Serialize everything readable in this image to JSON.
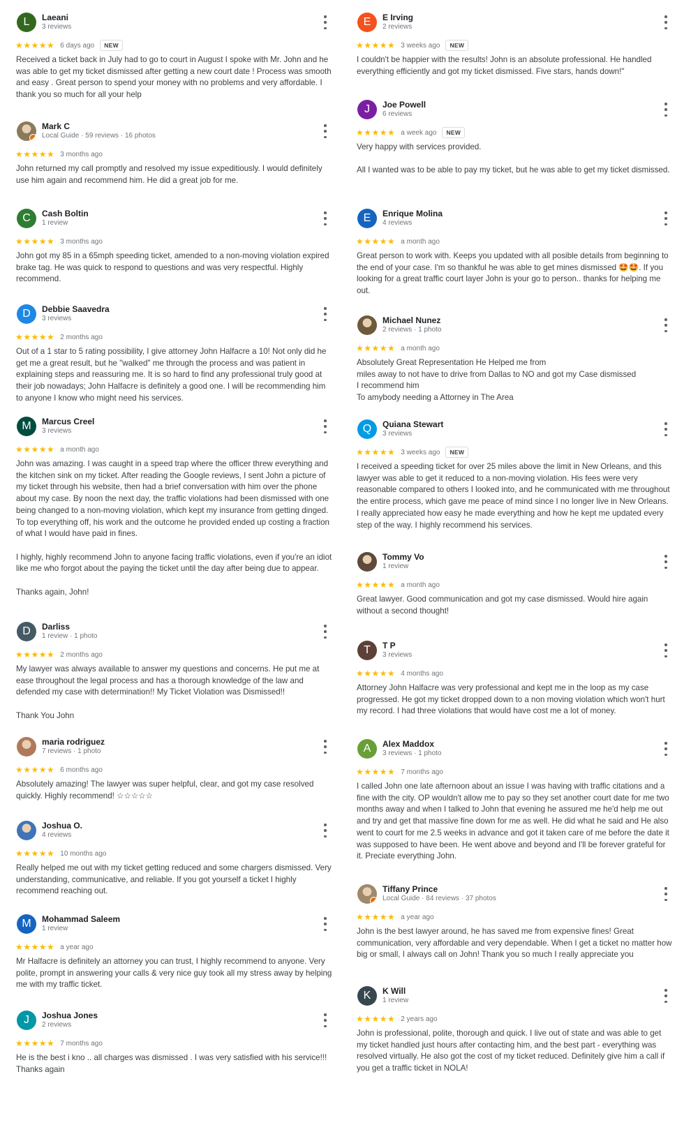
{
  "reviews_left": [
    {
      "name": "Laeani",
      "meta": "3 reviews",
      "initial": "L",
      "color": "#33691e",
      "photo": false,
      "stars": "★★★★★",
      "date": "6 days ago",
      "new": "NEW",
      "text": "Received a ticket back in July had to go to court in August I spoke with Mr. John and he was able to get my ticket dismissed after getting a new court date ! Process was smooth and easy . Great person to spend your money with no problems and very affordable. I thank you so much for all your help"
    },
    {
      "name": "Mark C",
      "meta": "Local Guide · 59 reviews · 16 photos",
      "initial": "M",
      "color": "#8a7a5c",
      "photo": true,
      "badge": true,
      "stars": "★★★★★",
      "date": "3 months ago",
      "new": "",
      "text": "John returned my call promptly and resolved my issue expeditiously. I would definitely use him again and recommend him. He did a great job for me."
    },
    {
      "name": "Cash Boltin",
      "meta": "1 review",
      "initial": "C",
      "color": "#2e7d32",
      "photo": false,
      "stars": "★★★★★",
      "date": "3 months ago",
      "new": "",
      "text": "John got my 85 in a 65mph speeding ticket, amended to a non-moving violation expired brake tag. He was quick to respond to questions and was very respectful. Highly recommend."
    },
    {
      "name": "Debbie Saavedra",
      "meta": "3 reviews",
      "initial": "D",
      "color": "#1e88e5",
      "photo": false,
      "stars": "★★★★★",
      "date": "2 months ago",
      "new": "",
      "text": "Out of a 1 star to 5 rating possibility, I give attorney John Halfacre a 10! Not only did he get me a great result, but he \"walked\" me through the process and was patient in explaining steps and reassuring me. It is so hard to find any professional truly good at their job nowadays; John Halfacre is definitely a good one. I will be recommending him to anyone I know who might need his services."
    },
    {
      "name": "Marcus Creel",
      "meta": "3 reviews",
      "initial": "M",
      "color": "#004d40",
      "photo": false,
      "stars": "★★★★★",
      "date": "a month ago",
      "new": "",
      "text": "John was amazing. I was caught in a speed trap where the officer threw everything and the kitchen sink on my ticket. After reading the Google reviews, I sent John a picture of my ticket through his website, then had a brief conversation with him over the phone about my case. By noon the next day, the traffic violations had been dismissed with one being changed to a non-moving violation, which kept my insurance from getting dinged. To top everything off, his work and the outcome he provided ended up costing a fraction of what I would have paid in fines.\n\nI highly, highly recommend John to anyone facing traffic violations, even if you're an idiot like me who forgot about the paying the ticket until the day after being due to appear.\n\nThanks again, John!"
    },
    {
      "name": "Darliss",
      "meta": "1 review · 1 photo",
      "initial": "D",
      "color": "#455a64",
      "photo": false,
      "stars": "★★★★★",
      "date": "2 months ago",
      "new": "",
      "text": "My lawyer was always available to answer my questions and concerns. He put me at ease throughout the legal process and has a thorough knowledge of the law and defended my case with determination!! My Ticket Violation was Dismissed!!\n\nThank You John"
    },
    {
      "name": "maria rodriguez",
      "meta": "7 reviews · 1 photo",
      "initial": "m",
      "color": "#b07a5a",
      "photo": true,
      "stars": "★★★★★",
      "date": "6 months ago",
      "new": "",
      "text": "Absolutely amazing! The lawyer was super helpful, clear, and got my case resolved quickly. Highly recommend! ☆☆☆☆☆"
    },
    {
      "name": "Joshua O.",
      "meta": "4 reviews",
      "initial": "J",
      "color": "#3f74b8",
      "photo": true,
      "stars": "★★★★★",
      "date": "10 months ago",
      "new": "",
      "text": "Really helped me out with my ticket getting reduced and some chargers dismissed. Very understanding, communicative, and reliable. If you got yourself a ticket I highly recommend reaching out."
    },
    {
      "name": "Mohammad Saleem",
      "meta": "1 review",
      "initial": "M",
      "color": "#1565c0",
      "photo": false,
      "stars": "★★★★★",
      "date": "a year ago",
      "new": "",
      "text": "Mr Halfacre is definitely an attorney you can trust, I highly recommend to anyone. Very polite, prompt in answering your calls & very nice guy took all my stress away by helping me with my traffic ticket."
    },
    {
      "name": "Joshua Jones",
      "meta": "2 reviews",
      "initial": "J",
      "color": "#0097a7",
      "photo": false,
      "stars": "★★★★★",
      "date": "7 months ago",
      "new": "",
      "text": "He is the best i kno .. all charges was dismissed . I was very satisfied with his service!!! Thanks again"
    }
  ],
  "reviews_right": [
    {
      "name": "E Irving",
      "meta": "2 reviews",
      "initial": "E",
      "color": "#f4511e",
      "photo": false,
      "stars": "★★★★★",
      "date": "3 weeks ago",
      "new": "NEW",
      "text": "I couldn't be happier with the results! John is an absolute professional. He handled everything efficiently and got my ticket dismissed. Five stars, hands down!\""
    },
    {
      "name": "Joe Powell",
      "meta": "6 reviews",
      "initial": "J",
      "color": "#7b1fa2",
      "photo": false,
      "stars": "★★★★★",
      "date": "a week ago",
      "new": "NEW",
      "text": "Very happy with services provided.\n\nAll I wanted was to be able to pay my ticket, but he was able to get my ticket dismissed."
    },
    {
      "name": "Enrique Molina",
      "meta": "4 reviews",
      "initial": "E",
      "color": "#1565c0",
      "photo": false,
      "stars": "★★★★★",
      "date": "a month ago",
      "new": "",
      "text": "Great person to work with. Keeps you updated with all posible details from beginning to the end of your case. I'm so thankful he was able to get mines dismissed 🤩🤩. If you looking for a great traffic court layer John is your go to person.. thanks for helping me out."
    },
    {
      "name": "Michael Nunez",
      "meta": "2 reviews · 1 photo",
      "initial": "M",
      "color": "#6d5a3a",
      "photo": true,
      "stars": "★★★★★",
      "date": "a month ago",
      "new": "",
      "text": "Absolutely Great Representation He Helped me from\nmiles away to not have to drive from Dallas to NO and got my Case dismissed\nI recommend him\nTo amybody needing a Attorney in The Area"
    },
    {
      "name": "Quiana Stewart",
      "meta": "3 reviews",
      "initial": "Q",
      "color": "#039be5",
      "photo": false,
      "stars": "★★★★★",
      "date": "3 weeks ago",
      "new": "NEW",
      "text": "I received a speeding ticket for over 25 miles above the limit in New Orleans, and this lawyer was able to get it reduced to a non-moving violation. His fees were very reasonable compared to others I looked into, and he communicated with me throughout the entire process, which gave me peace of mind since I no longer live in New Orleans. I really appreciated how easy he made everything and how he kept me updated every step of the way. I highly recommend his services."
    },
    {
      "name": "Tommy Vo",
      "meta": "1 review",
      "initial": "T",
      "color": "#5d4a3a",
      "photo": true,
      "stars": "★★★★★",
      "date": "a month ago",
      "new": "",
      "text": "Great lawyer. Good communication and got my case dismissed. Would hire again without a second thought!"
    },
    {
      "name": "T P",
      "meta": "3 reviews",
      "initial": "T",
      "color": "#5d4037",
      "photo": false,
      "stars": "★★★★★",
      "date": "4 months ago",
      "new": "",
      "text": "Attorney John Halfacre was very professional and kept me in the loop as my case progressed. He got my ticket dropped down to a non moving violation which won't hurt my record. I had three violations that would have cost me a lot of money."
    },
    {
      "name": "Alex Maddox",
      "meta": "3 reviews · 1 photo",
      "initial": "A",
      "color": "#689f38",
      "photo": false,
      "stars": "★★★★★",
      "date": "7 months ago",
      "new": "",
      "text": "I called John one late afternoon about an issue I was having with traffic citations and a fine with the city. OP wouldn't allow me to pay so they set another court date for me two months away and when I talked to John that evening he assured me he'd help me out and try and get that massive fine down for me as well. He did what he said and He also went to court for me 2.5 weeks in advance and got it taken care of me before the date it was supposed to have been. He went above and beyond and I'll be forever grateful for it. Preciate everything John."
    },
    {
      "name": "Tiffany Prince",
      "meta": "Local Guide · 84 reviews · 37 photos",
      "initial": "T",
      "color": "#9e8a6a",
      "photo": true,
      "badge": true,
      "stars": "★★★★★",
      "date": "a year ago",
      "new": "",
      "text": "John is the best lawyer around, he has saved me from expensive fines! Great communication, very affordable and very dependable. When I get a ticket no matter how big or small, I always call on John! Thank you so much I really appreciate you"
    },
    {
      "name": "K Will",
      "meta": "1 review",
      "initial": "K",
      "color": "#37474f",
      "photo": false,
      "stars": "★★★★★",
      "date": "2 years ago",
      "new": "",
      "text": "John is professional, polite, thorough and quick. I live out of state and was able to get my ticket handled just hours after contacting him, and the best part - everything was resolved virtually. He also got the cost of my ticket reduced. Definitely give him a call if you get a traffic ticket in NOLA!"
    }
  ]
}
